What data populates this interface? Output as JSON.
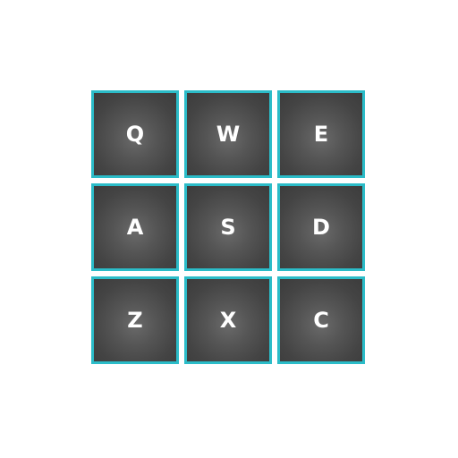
{
  "keypad": {
    "keys": [
      {
        "label": "Q"
      },
      {
        "label": "W"
      },
      {
        "label": "E"
      },
      {
        "label": "A"
      },
      {
        "label": "S"
      },
      {
        "label": "D"
      },
      {
        "label": "Z"
      },
      {
        "label": "X"
      },
      {
        "label": "C"
      }
    ]
  },
  "colors": {
    "key_border": "#2bbcc8",
    "key_fill": "#4a4a4a",
    "key_text": "#ffffff",
    "background": "#ffffff"
  }
}
